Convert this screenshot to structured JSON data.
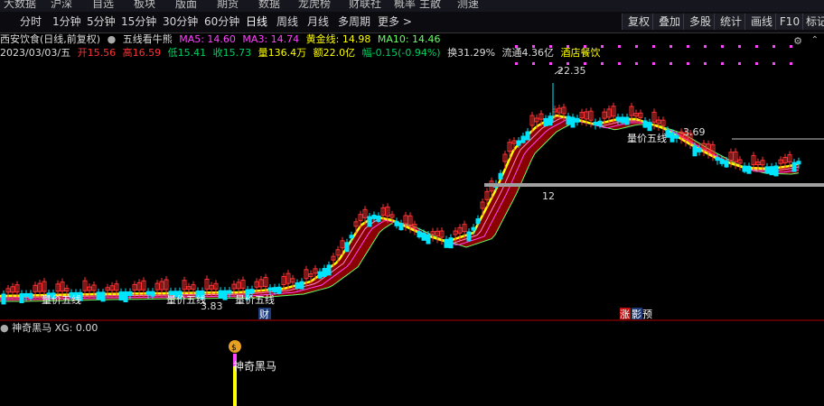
{
  "top_nav": [
    "大数据",
    "沪深",
    "自选",
    "板块",
    "版面",
    "期货",
    "数据",
    "龙虎榜",
    "财联社",
    "概率",
    "主散",
    "测速"
  ],
  "tabs": [
    "分时",
    "1分钟",
    "5分钟",
    "15分钟",
    "30分钟",
    "60分钟",
    "日线",
    "周线",
    "月线",
    "多周期",
    "更多 >"
  ],
  "right_buttons": [
    "复权",
    "叠加",
    "多股",
    "统计",
    "画线",
    "F10",
    "标记"
  ],
  "stock": {
    "name": "西安饮食(日线,前复权)",
    "indicator_name": "五线看牛熊",
    "ma5": "MA5: 14.60",
    "ma3": "MA3: 14.74",
    "gold_line": "黄金线: 14.98",
    "ma10": "MA10: 14.46"
  },
  "quote": {
    "date": "2023/03/03/五",
    "open": "开15.56",
    "high": "高16.59",
    "low": "低15.41",
    "close": "收15.73",
    "volume": "量136.4万",
    "amount": "额22.0亿",
    "change": "幅-0.15(-0.94%)",
    "turnover": "换31.29%",
    "float_cap": "流通4.36亿",
    "industry": "酒店餐饮"
  },
  "annotations": {
    "high_price": "22.35",
    "low_price": "3.83",
    "partial_price": "3.69",
    "partial_low": "12",
    "signal_label": "量价五线",
    "cai_marker": "财",
    "zhang_marker": "涨",
    "ying_marker": "影",
    "yu_marker": "预"
  },
  "sub_panel": {
    "name": "神奇黑马",
    "xg_value": "XG: 0.00",
    "signal_label": "神奇黑马"
  },
  "colors": {
    "up": "#ff3333",
    "down": "#00e5ff",
    "ma_yellow": "#ffff00",
    "ma_magenta": "#ff44ff",
    "ma_green": "#66ff66",
    "ribbon": "#8b0000",
    "close_line": "#c8c8c8"
  },
  "icons": [
    "settings-circle-icon",
    "chevron-up-icon",
    "money-bag-icon",
    "arrow-indicator-icon"
  ]
}
